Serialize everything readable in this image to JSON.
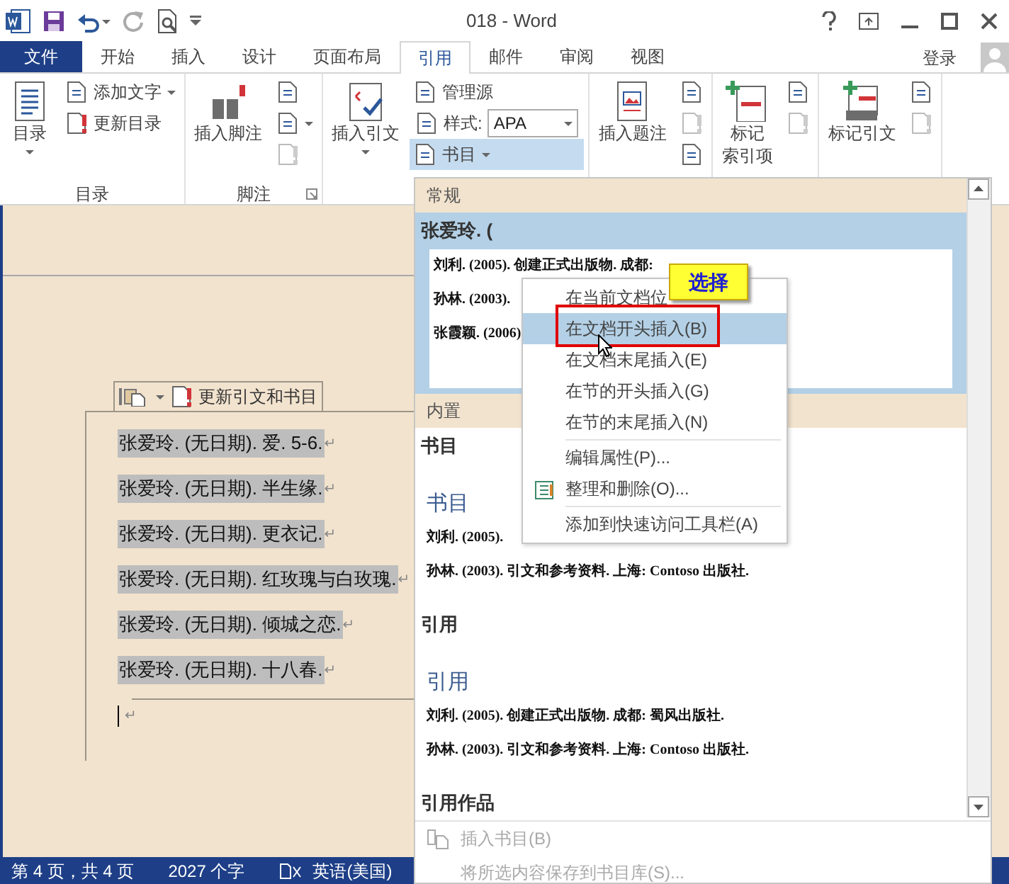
{
  "title_bar": {
    "title": "018 - Word"
  },
  "tabs": [
    {
      "label": "文件",
      "kind": "file",
      "selected": false
    },
    {
      "label": "开始",
      "kind": "tab",
      "selected": false
    },
    {
      "label": "插入",
      "kind": "tab",
      "selected": false
    },
    {
      "label": "设计",
      "kind": "tab",
      "selected": false
    },
    {
      "label": "页面布局",
      "kind": "tab",
      "selected": false
    },
    {
      "label": "引用",
      "kind": "tab",
      "selected": true
    },
    {
      "label": "邮件",
      "kind": "tab",
      "selected": false
    },
    {
      "label": "审阅",
      "kind": "tab",
      "selected": false
    },
    {
      "label": "视图",
      "kind": "tab",
      "selected": false
    }
  ],
  "account": {
    "label": "登录"
  },
  "ribbon": {
    "groups": [
      {
        "label": "目录",
        "launcher": false,
        "items": [
          {
            "kind": "large",
            "lines": [
              "目录"
            ],
            "dropdown": true
          },
          {
            "kind": "stack",
            "rows": [
              {
                "kind": "button",
                "label": "添加文字",
                "dropdown": true
              },
              {
                "kind": "button",
                "label": "更新目录",
                "dropdown": false
              }
            ]
          }
        ]
      },
      {
        "label": "脚注",
        "launcher": true,
        "items": [
          {
            "kind": "large",
            "lines": [
              "插入脚注"
            ],
            "dropdown": false
          },
          {
            "kind": "stack",
            "rows": [
              {
                "kind": "icon",
                "disabled": false,
                "dropdown": false
              },
              {
                "kind": "icon",
                "disabled": false,
                "dropdown": true
              },
              {
                "kind": "icon",
                "disabled": true,
                "dropdown": false
              }
            ]
          }
        ]
      },
      {
        "launcher": false,
        "items": [
          {
            "kind": "large",
            "lines": [
              "插入引文"
            ],
            "dropdown": true
          },
          {
            "kind": "stack",
            "rows": [
              {
                "kind": "button",
                "label": "管理源",
                "dropdown": false
              },
              {
                "kind": "combo",
                "label": "样式:",
                "value": "APA"
              },
              {
                "kind": "button",
                "label": "书目",
                "dropdown": true,
                "expanded": true
              }
            ]
          }
        ]
      },
      {
        "launcher": false,
        "items": [
          {
            "kind": "large",
            "lines": [
              "插入题注"
            ],
            "dropdown": false
          },
          {
            "kind": "stack",
            "rows": [
              {
                "kind": "icon",
                "disabled": false,
                "dropdown": false
              },
              {
                "kind": "icon",
                "disabled": true,
                "dropdown": false
              },
              {
                "kind": "icon",
                "disabled": false,
                "dropdown": false
              }
            ]
          }
        ]
      },
      {
        "launcher": false,
        "items": [
          {
            "kind": "large",
            "lines": [
              "标记",
              "索引项"
            ],
            "dropdown": false
          },
          {
            "kind": "stack",
            "rows": [
              {
                "kind": "icon",
                "disabled": false,
                "dropdown": false
              },
              {
                "kind": "icon",
                "disabled": true,
                "dropdown": false
              }
            ]
          }
        ]
      },
      {
        "launcher": false,
        "items": [
          {
            "kind": "large",
            "lines": [
              "标记引文"
            ],
            "dropdown": false
          },
          {
            "kind": "stack",
            "rows": [
              {
                "kind": "icon",
                "disabled": false,
                "dropdown": false
              },
              {
                "kind": "icon",
                "disabled": true,
                "dropdown": false
              }
            ]
          }
        ]
      }
    ]
  },
  "document": {
    "control_toolbar": {
      "update_label": "更新引文和书目"
    },
    "entries": [
      {
        "text": "张爱玲. (无日期). 爱. 5-6.",
        "mark": "↵"
      },
      {
        "text": "张爱玲. (无日期). 半生缘.",
        "mark": "↵"
      },
      {
        "text": "张爱玲. (无日期). 更衣记.",
        "mark": "↵"
      },
      {
        "text": "张爱玲. (无日期). 红玫瑰与白玫瑰.",
        "mark": "↵"
      },
      {
        "text": "张爱玲. (无日期). 倾城之恋.",
        "mark": "↵"
      },
      {
        "text": "张爱玲. (无日期). 十八春.",
        "mark": "↵"
      }
    ],
    "empty_mark": "↵"
  },
  "bibliography_gallery": {
    "sections": [
      {
        "kind": "header",
        "label": "常规"
      },
      {
        "kind": "entry",
        "label": "张爱玲. (",
        "selected": true,
        "preview": {
          "lines": [
            "刘利. (2005). 创建正式出版物. 成都:",
            "孙林. (2003).",
            "张霞颖. (2006)"
          ]
        }
      },
      {
        "kind": "header",
        "label": "内置"
      },
      {
        "kind": "entry",
        "label": "书目",
        "selected": false,
        "preview": {
          "heading": "书目",
          "lines": [
            "刘利. (2005).",
            "孙林. (2003). 引文和参考资料. 上海: Contoso 出版社."
          ]
        }
      },
      {
        "kind": "entry",
        "label": "引用",
        "selected": false,
        "preview": {
          "heading": "引用",
          "lines": [
            "刘利. (2005). 创建正式出版物. 成都: 蜀风出版社.",
            "孙林. (2003). 引文和参考资料. 上海: Contoso 出版社."
          ]
        }
      },
      {
        "kind": "entry",
        "label": "引用作品",
        "selected": false
      }
    ],
    "commands": [
      {
        "label": "插入书目(B)",
        "disabled": true,
        "has_icon": true
      },
      {
        "label": "将所选内容保存到书目库(S)...",
        "disabled": true,
        "has_icon": false
      }
    ]
  },
  "context_menu": {
    "items": [
      {
        "kind": "item",
        "label": "在当前文档位",
        "selected": false
      },
      {
        "kind": "item",
        "label": "在文档开头插入(B)",
        "selected": true
      },
      {
        "kind": "item",
        "label": "在文档末尾插入(E)",
        "selected": false
      },
      {
        "kind": "item",
        "label": "在节的开头插入(G)",
        "selected": false
      },
      {
        "kind": "item",
        "label": "在节的末尾插入(N)",
        "selected": false
      },
      {
        "kind": "separator"
      },
      {
        "kind": "item",
        "label": "编辑属性(P)...",
        "selected": false
      },
      {
        "kind": "item",
        "label": "整理和删除(O)...",
        "selected": false,
        "has_icon": true
      },
      {
        "kind": "separator"
      },
      {
        "kind": "item",
        "label": "添加到快速访问工具栏(A)",
        "selected": false
      }
    ]
  },
  "callout": {
    "label": "选择"
  },
  "status_bar": {
    "page": "第 4 页，共 4 页",
    "words": "2027 个字",
    "language": "英语(美国)"
  }
}
